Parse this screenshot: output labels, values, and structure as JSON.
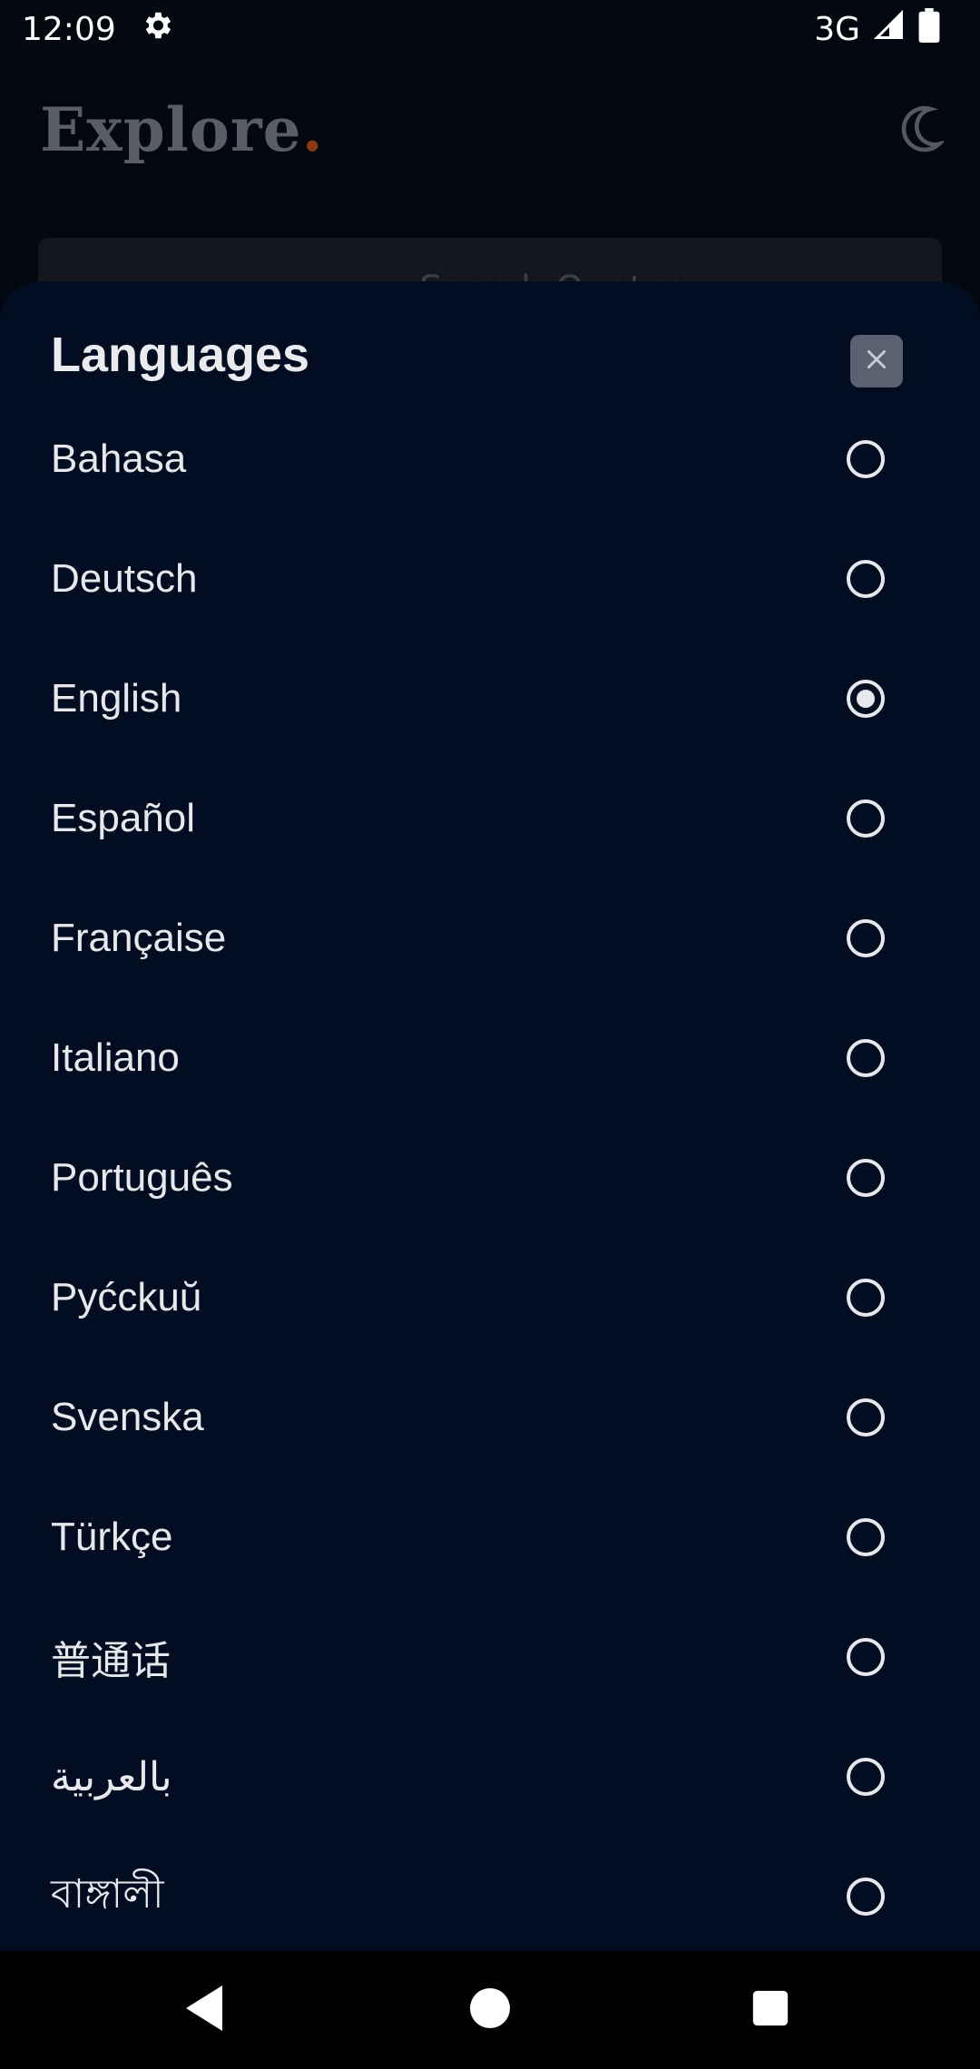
{
  "status_bar": {
    "time": "12:09",
    "network": "3G",
    "icons": [
      "settings-icon",
      "signal-icon",
      "battery-icon"
    ]
  },
  "app": {
    "title": "Explore",
    "title_dot": ".",
    "search_placeholder": "Search Quotes"
  },
  "sheet": {
    "title": "Languages",
    "close_icon": "close-icon",
    "languages": [
      {
        "label": "Bahasa",
        "selected": false
      },
      {
        "label": "Deutsch",
        "selected": false
      },
      {
        "label": "English",
        "selected": true
      },
      {
        "label": "Español",
        "selected": false
      },
      {
        "label": "Française",
        "selected": false
      },
      {
        "label": "Italiano",
        "selected": false
      },
      {
        "label": "Português",
        "selected": false
      },
      {
        "label": "Pyćckuŭ",
        "selected": false
      },
      {
        "label": "Svenska",
        "selected": false
      },
      {
        "label": "Türkçe",
        "selected": false
      },
      {
        "label": "普通话",
        "selected": false
      },
      {
        "label": "بالعربية",
        "selected": false
      },
      {
        "label": "বাঙ্গালী",
        "selected": false
      }
    ]
  },
  "nav_bar": {
    "icons": [
      "back-icon",
      "home-icon",
      "recents-icon"
    ]
  },
  "colors": {
    "sheet_background": "#020d21",
    "screen_background": "#03070f",
    "accent_dot": "#8a3a14",
    "text": "#e6e8ec"
  }
}
